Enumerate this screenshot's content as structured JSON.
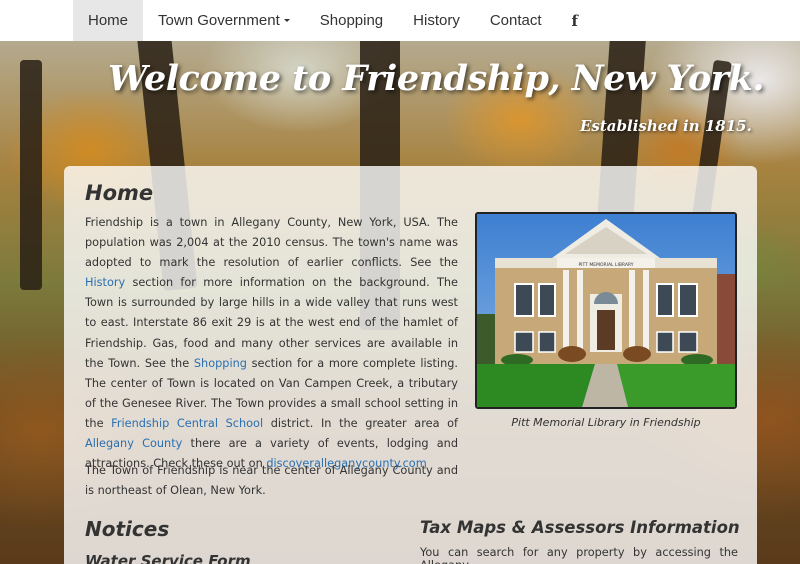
{
  "navbar": {
    "items": [
      {
        "label": "Home",
        "active": true
      },
      {
        "label": "Town Government",
        "dropdown": true
      },
      {
        "label": "Shopping"
      },
      {
        "label": "History"
      },
      {
        "label": "Contact"
      }
    ],
    "facebook_glyph": "f",
    "facebook_icon": "facebook-icon"
  },
  "hero": {
    "title": "Welcome to Friendship, New York.",
    "subtitle": "Established in 1815."
  },
  "home": {
    "heading": "Home",
    "p1": {
      "t1": "Friendship is a town in Allegany County, New York, USA. The population was 2,004 at the 2010 census. The town's name was adopted to mark the resolution of earlier conflicts. See the ",
      "link_history": "History",
      "t2": " section for more information on the background. The Town is surrounded by large hills in a wide valley that runs west to east. Interstate 86 exit 29 is at the west end of the hamlet of Friendship. Gas, food and many other services are available in the Town. See the ",
      "link_shopping": "Shopping",
      "t3": " section for a more complete listing. The center of Town is located on Van Campen Creek, a tributary of the Genesee River. The Town provides a small school setting in the ",
      "link_school": "Friendship Central School",
      "t4": " district. In the greater area of ",
      "link_allegany": "Allegany County",
      "t5": " there are a variety of events, lodging and attractions. Check these out on ",
      "link_discover": "discoveralleganycounty.com"
    },
    "p2": "The Town of Friendship is near the center of Allegany County and is northeast of Olean, New York.",
    "photo_sign": "PITT MEMORIAL LIBRARY",
    "photo_caption": "Pitt Memorial Library in Friendship"
  },
  "notices": {
    "heading": "Notices",
    "subheading": "Water Service Form"
  },
  "tax": {
    "heading": "Tax Maps & Assessors Information",
    "text": "You can search for any property by accessing the Allegany"
  },
  "colors": {
    "link": "#2a6fb0",
    "nav_active_bg": "#e7e7e7",
    "text": "#333333"
  }
}
